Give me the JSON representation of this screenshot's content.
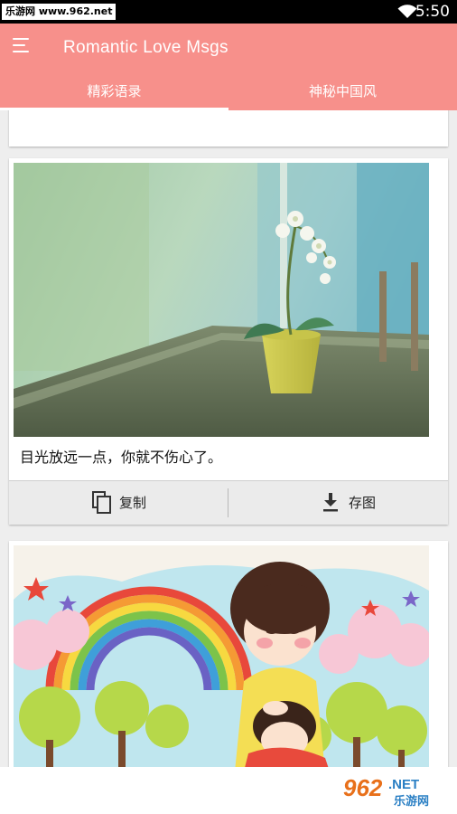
{
  "status_bar": {
    "watermark": "乐游网 www.962.net",
    "time": "5:50",
    "icons": [
      "wifi-icon"
    ]
  },
  "app_bar": {
    "title": "Romantic Love Msgs",
    "menu_icon": "menu-icon",
    "background": "#f7908b"
  },
  "tabs": [
    {
      "label": "精彩语录",
      "selected": true
    },
    {
      "label": "神秘中国风",
      "selected": false
    }
  ],
  "cards": [
    {
      "caption": "目光放远一点，你就不伤心了。",
      "image": "green-window-orchid-photo",
      "actions": {
        "copy_label": "复制",
        "copy_icon": "copy-icon",
        "save_label": "存图",
        "save_icon": "download-icon"
      }
    },
    {
      "image": "cartoon-rainbow-couple-illustration"
    }
  ],
  "footer_logo": {
    "text_962": "962",
    "text_net": ".NET",
    "text_cn": "乐游网"
  }
}
